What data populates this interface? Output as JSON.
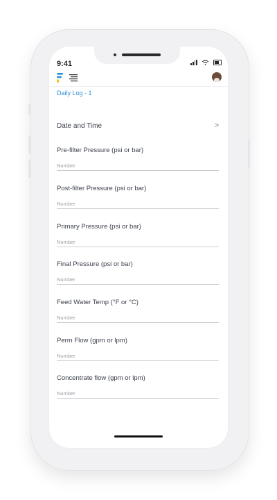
{
  "status_bar": {
    "time": "9:41"
  },
  "app": {
    "breadcrumb": "Daily Log - 1",
    "icons": {
      "logo": "brand-logo-icon",
      "menu": "menu-icon",
      "profile": "avatar"
    },
    "accent_color": "#2b8fd6"
  },
  "date_time": {
    "label": "Date and Time",
    "chevron": ">"
  },
  "fields": [
    {
      "label": "Pre-filter Pressure (psi or bar)",
      "placeholder": "Number"
    },
    {
      "label": "Post-filter Pressure (psi or bar)",
      "placeholder": "Number"
    },
    {
      "label": "Primary Pressure (psi or bar)",
      "placeholder": "Number"
    },
    {
      "label": "Final Pressure (psi or bar)",
      "placeholder": "Number"
    },
    {
      "label": "Feed Water Temp (°F or °C)",
      "placeholder": "Number"
    },
    {
      "label": "Perm Flow (gpm or lpm)",
      "placeholder": "Number"
    },
    {
      "label": "Concentrate flow (gpm or lpm)",
      "placeholder": "Number"
    }
  ]
}
